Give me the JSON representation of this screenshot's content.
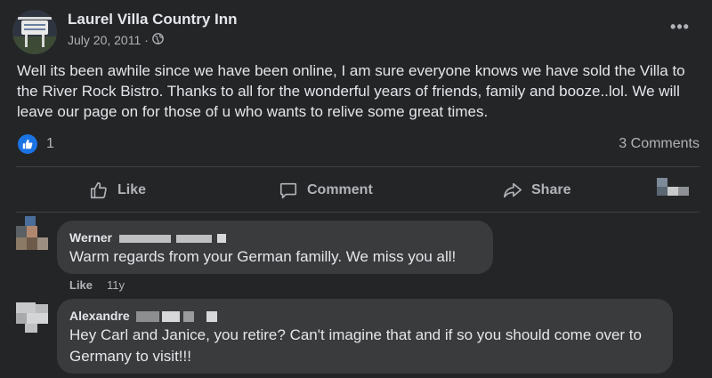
{
  "post": {
    "page_name": "Laurel Villa Country Inn",
    "date": "July 20, 2011",
    "separator": "·",
    "text": "Well its been awhile since we have been online, I am sure everyone knows we have sold the Villa to the River Rock Bistro. Thanks to all for the wonderful years of friends, family and booze..lol. We will leave our page on for those of u who wants to relive some great times.",
    "reaction_count": "1",
    "comments_count": "3 Comments",
    "more_label": "•••",
    "privacy_icon": "globe-icon"
  },
  "actions": {
    "like_label": "Like",
    "comment_label": "Comment",
    "share_label": "Share"
  },
  "comments": [
    {
      "author": "Werner",
      "text": "Warm regards from your German familly. We miss you all!",
      "like_label": "Like",
      "time": "11y"
    },
    {
      "author": "Alexandre",
      "text": "Hey Carl and Janice, you retire? Can't imagine that and if so you should come over to Germany to visit!!!"
    }
  ],
  "colors": {
    "background": "#242526",
    "bubble": "#3a3b3c",
    "text_primary": "#e4e6eb",
    "text_secondary": "#b0b3b8",
    "like_blue": "#1b74e4"
  }
}
